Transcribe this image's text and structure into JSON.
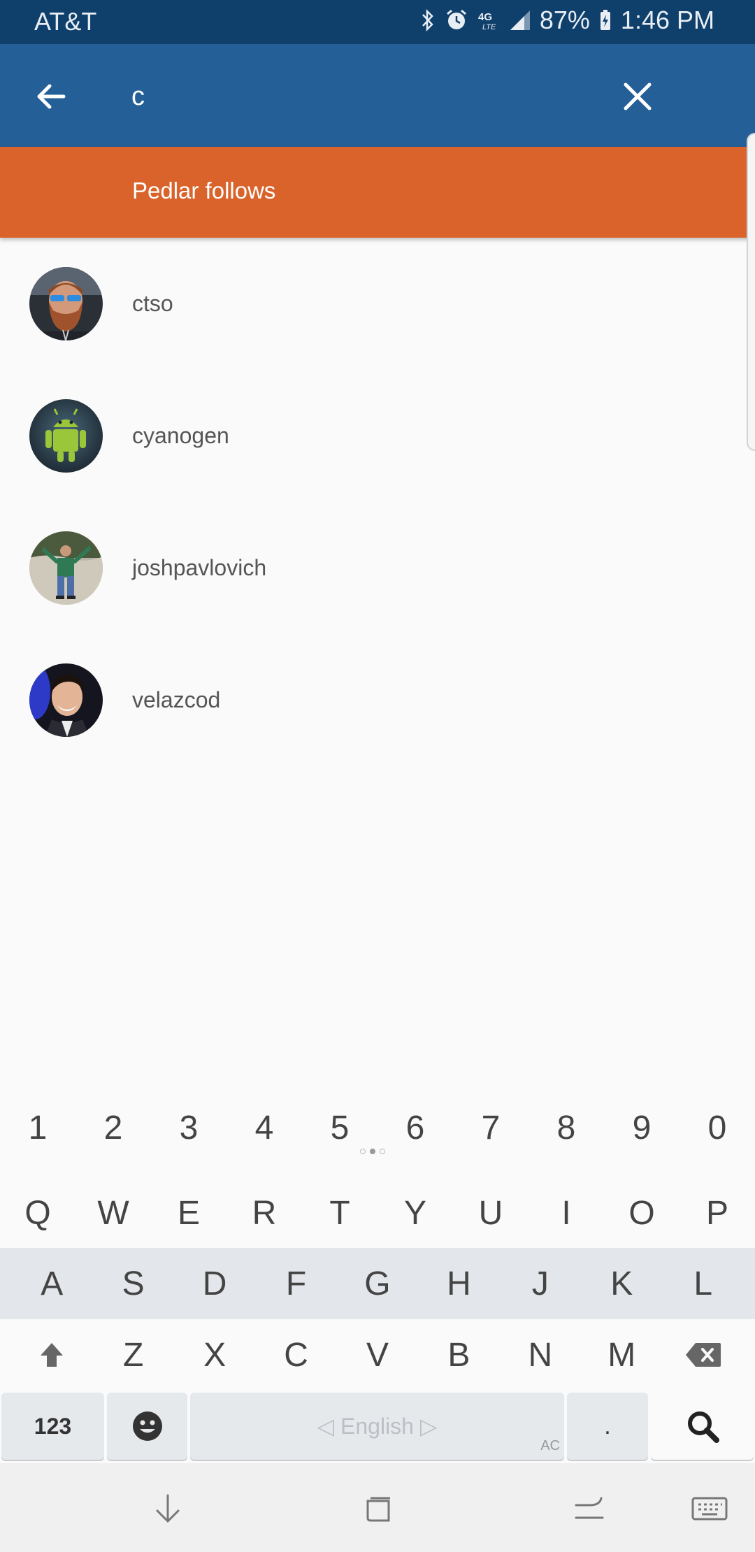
{
  "status_bar": {
    "carrier": "AT&T",
    "battery": "87%",
    "time": "1:46 PM",
    "network": "4G LTE"
  },
  "search": {
    "value": "c",
    "placeholder": ""
  },
  "section": {
    "title": "Pedlar follows"
  },
  "users": [
    {
      "name": "ctso",
      "avatar": "avatar-ctso"
    },
    {
      "name": "cyanogen",
      "avatar": "avatar-cyanogen"
    },
    {
      "name": "joshpavlovich",
      "avatar": "avatar-joshpavlovich"
    },
    {
      "name": "velazcod",
      "avatar": "avatar-velazcod"
    }
  ],
  "keyboard": {
    "numbers": [
      "1",
      "2",
      "3",
      "4",
      "5",
      "6",
      "7",
      "8",
      "9",
      "0"
    ],
    "row1": [
      "Q",
      "W",
      "E",
      "R",
      "T",
      "Y",
      "U",
      "I",
      "O",
      "P"
    ],
    "row2": [
      "A",
      "S",
      "D",
      "F",
      "G",
      "H",
      "J",
      "K",
      "L"
    ],
    "row3": [
      "Z",
      "X",
      "C",
      "V",
      "B",
      "N",
      "M"
    ],
    "key_123": "123",
    "space_label": "◁ English ▷",
    "period": ".",
    "ac_label": "AC"
  },
  "colors": {
    "status_bar": "#0f3f6b",
    "app_bar": "#246097",
    "section_header": "#d9632a"
  }
}
